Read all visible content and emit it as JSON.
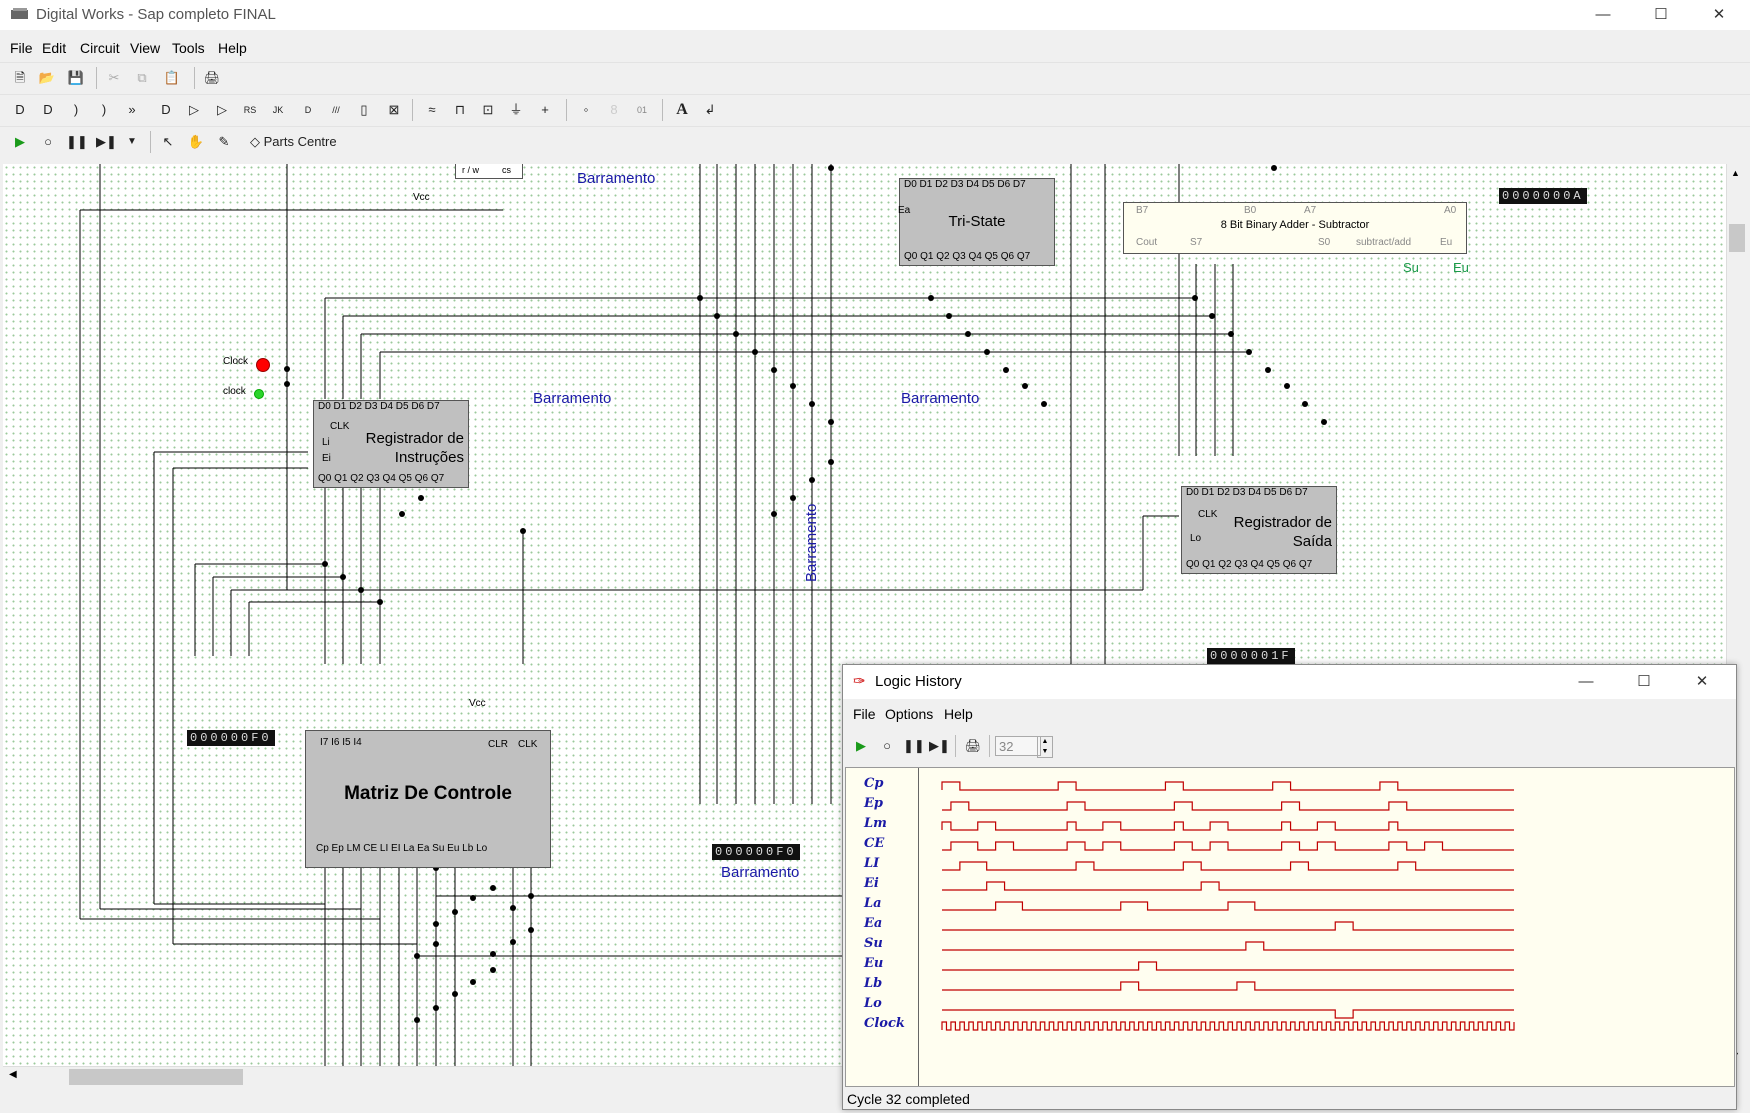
{
  "window": {
    "title": "Digital Works - Sap completo FINAL"
  },
  "menu": [
    "File",
    "Edit",
    "Circuit",
    "View",
    "Tools",
    "Help"
  ],
  "toolbar": {
    "parts_centre": "Parts Centre"
  },
  "circuit": {
    "bus_label": "Barramento",
    "tristate": {
      "name": "Tri-State",
      "enable": "Ea",
      "d_pins": "D0 D1 D2 D3 D4 D5 D6 D7",
      "q_pins": "Q0 Q1 Q2 Q3 Q4 Q5 Q6 Q7"
    },
    "adder": {
      "name": "8 Bit Binary Adder - Subtractor",
      "b7": "B7",
      "b0": "B0",
      "a7": "A7",
      "a0": "A0",
      "cout": "Cout",
      "s7": "S7",
      "s0": "S0",
      "subadd": "subtract/add",
      "eu": "Eu",
      "out_su": "Su",
      "out_eu": "Eu"
    },
    "instr_reg": {
      "name_line1": "Registrador de",
      "name_line2": "Instruções",
      "d_pins": "D0 D1 D2 D3 D4 D5 D6 D7",
      "q_pins": "Q0 Q1 Q2 Q3 Q4 Q5 Q6 Q7",
      "clk": "CLK",
      "li": "Li",
      "ei": "Ei"
    },
    "out_reg": {
      "name_line1": "Registrador de",
      "name_line2": "Saída",
      "d_pins": "D0 D1 D2 D3 D4 D5 D6 D7",
      "q_pins": "Q0 Q1 Q2 Q3 Q4 Q5 Q6 Q7",
      "clk": "CLK",
      "lo": "Lo"
    },
    "control": {
      "name": "Matriz De Controle",
      "inputs": "I7 I6 I5 I4",
      "clr": "CLR",
      "clk": "CLK",
      "vcc": "Vcc",
      "outputs": "Cp Ep LM CE LI EI La Ea Su Eu Lb Lo"
    },
    "clock_label": "Clock",
    "clock2_label": "clock",
    "vcc_label": "Vcc",
    "rw_label": "r / w",
    "cs_label": "cs",
    "hex_a": "0000000A",
    "hex_out": "0000001F",
    "hex_instr": "000000F0",
    "hex_bus": "000000F0"
  },
  "logic_history": {
    "title": "Logic History",
    "menu": [
      "File",
      "Options",
      "Help"
    ],
    "cycles": "32",
    "signals": [
      "Cp",
      "Ep",
      "Lm",
      "CE",
      "LI",
      "Ei",
      "La",
      "Ea",
      "Su",
      "Eu",
      "Lb",
      "Lo",
      "Clock"
    ],
    "status": "Cycle 32 completed"
  },
  "colors": {
    "wave": "#c00000",
    "bus_label": "#1a1aa6",
    "chip_fill": "#c0c0c0",
    "clock_led": "#ff0000"
  }
}
